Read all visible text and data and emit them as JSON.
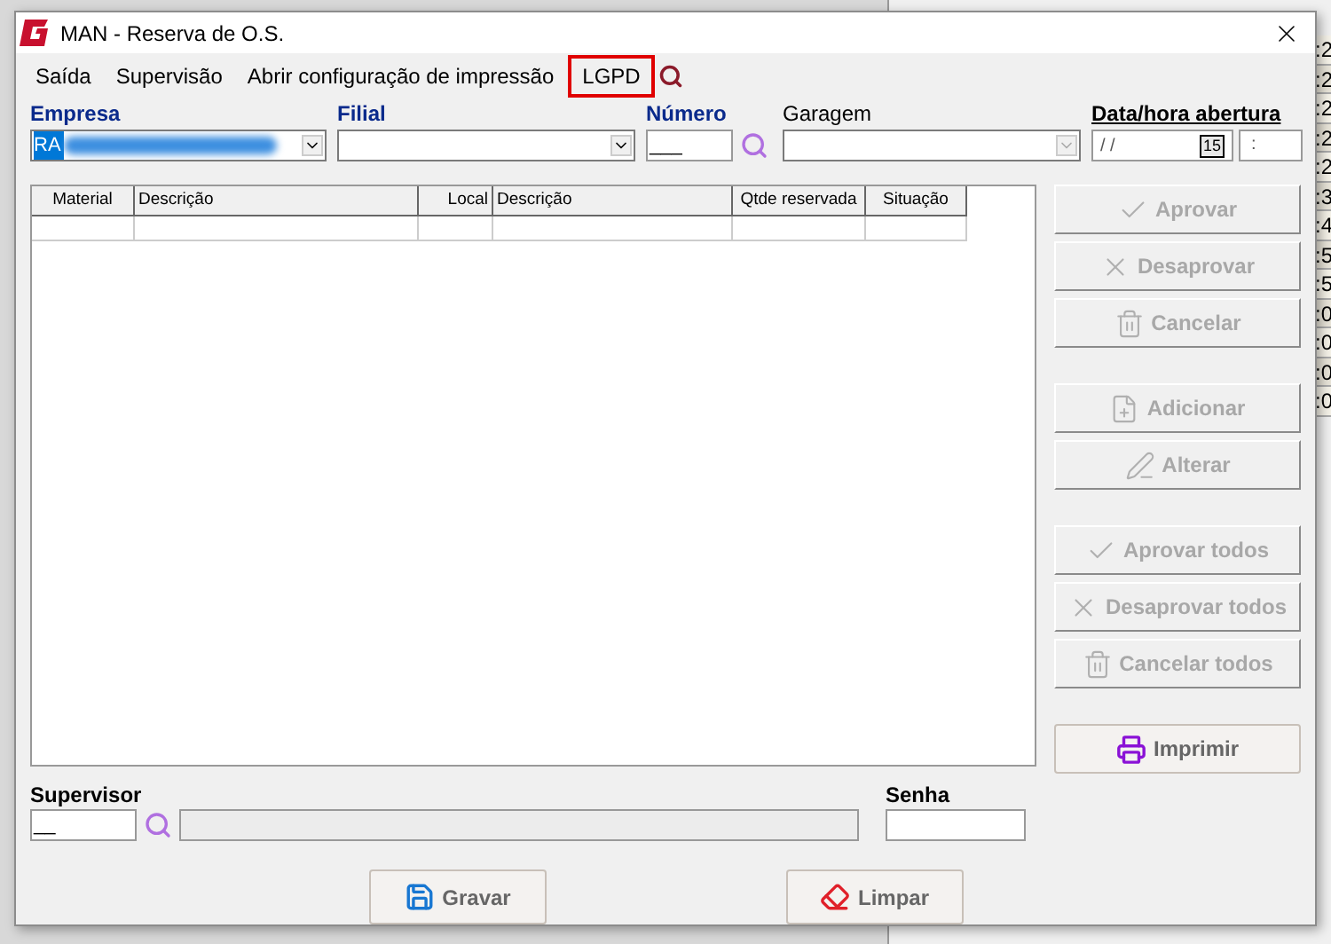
{
  "background_app": {
    "cells": [
      ":2",
      ":2",
      ":2",
      ":2",
      ":2",
      ":3",
      ":4",
      ":5",
      ":5",
      ":0",
      ":0",
      ":0",
      ":0"
    ]
  },
  "window": {
    "title": "MAN - Reserva de O.S."
  },
  "menu": [
    {
      "label": "Saída",
      "highlighted": false
    },
    {
      "label": "Supervisão",
      "highlighted": false
    },
    {
      "label": "Abrir configuração de impressão",
      "highlighted": false
    },
    {
      "label": "LGPD",
      "highlighted": true
    }
  ],
  "fields": {
    "empresa": {
      "label": "Empresa",
      "value": "RA"
    },
    "filial": {
      "label": "Filial"
    },
    "numero": {
      "label": "Número",
      "value": "___"
    },
    "garagem": {
      "label": "Garagem"
    },
    "data_hora": {
      "label": "Data/hora abertura",
      "date": "/ /",
      "calendar": "15",
      "time": ":"
    }
  },
  "table": {
    "columns": [
      "Material",
      "Descrição",
      "Local",
      "Descrição",
      "Qtde reservada",
      "Situação"
    ]
  },
  "side_button_groups": [
    [
      {
        "label": "Aprovar",
        "kind": "check",
        "disabled": true
      },
      {
        "label": "Desaprovar",
        "kind": "cross",
        "disabled": true
      },
      {
        "label": "Cancelar",
        "kind": "trash",
        "disabled": true
      }
    ],
    [
      {
        "label": "Adicionar",
        "kind": "add",
        "disabled": true
      },
      {
        "label": "Alterar",
        "kind": "edit",
        "disabled": true
      }
    ],
    [
      {
        "label": "Aprovar todos",
        "kind": "check",
        "disabled": true
      },
      {
        "label": "Desaprovar todos",
        "kind": "cross",
        "disabled": true
      },
      {
        "label": "Cancelar todos",
        "kind": "trash",
        "disabled": true
      }
    ],
    [
      {
        "label": "Imprimir",
        "kind": "print",
        "disabled": false
      }
    ]
  ],
  "supervisor": {
    "label": "Supervisor",
    "value": "__"
  },
  "senha": {
    "label": "Senha"
  },
  "bottom_buttons": [
    {
      "label": "Gravar",
      "kind": "save",
      "disabled": false
    },
    {
      "label": "Limpar",
      "kind": "eraser",
      "disabled": false
    }
  ]
}
